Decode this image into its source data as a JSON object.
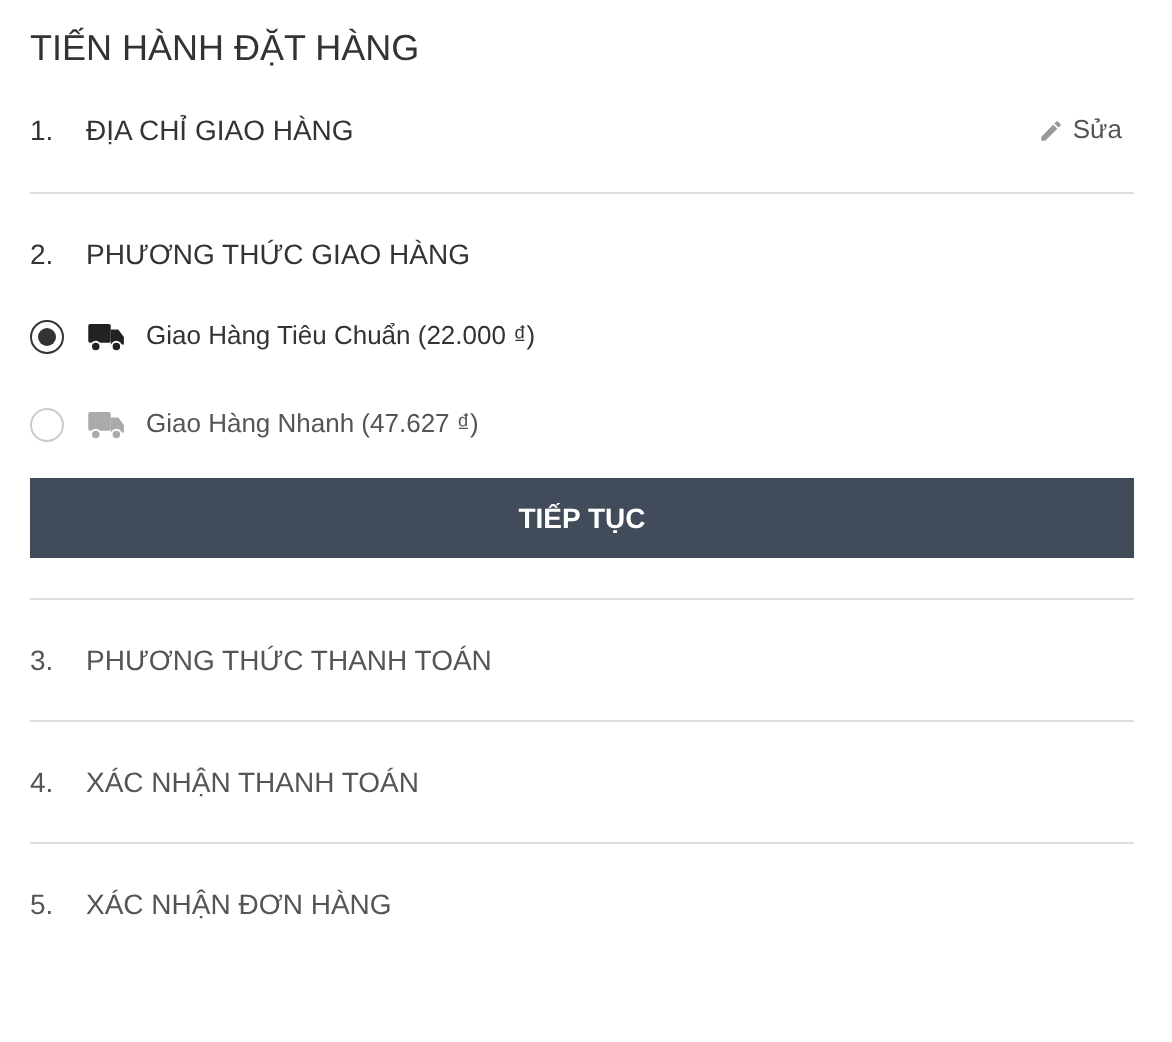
{
  "title": "TIẾN HÀNH ĐẶT HÀNG",
  "steps": [
    {
      "number": "1.",
      "label": "ĐỊA CHỈ GIAO HÀNG",
      "completed": true,
      "expanded": false,
      "edit_label": "Sửa"
    },
    {
      "number": "2.",
      "label": "PHƯƠNG THỨC GIAO HÀNG",
      "completed": false,
      "expanded": true,
      "options": [
        {
          "label": "Giao Hàng Tiêu Chuẩn (22.000 ₫)",
          "selected": true
        },
        {
          "label": "Giao Hàng Nhanh (47.627 ₫)",
          "selected": false
        }
      ],
      "button": "TIẾP TỤC"
    },
    {
      "number": "3.",
      "label": "PHƯƠNG THỨC THANH TOÁN",
      "completed": false,
      "expanded": false
    },
    {
      "number": "4.",
      "label": "XÁC NHẬN THANH TOÁN",
      "completed": false,
      "expanded": false
    },
    {
      "number": "5.",
      "label": "XÁC NHẬN ĐƠN HÀNG",
      "completed": false,
      "expanded": false
    }
  ]
}
